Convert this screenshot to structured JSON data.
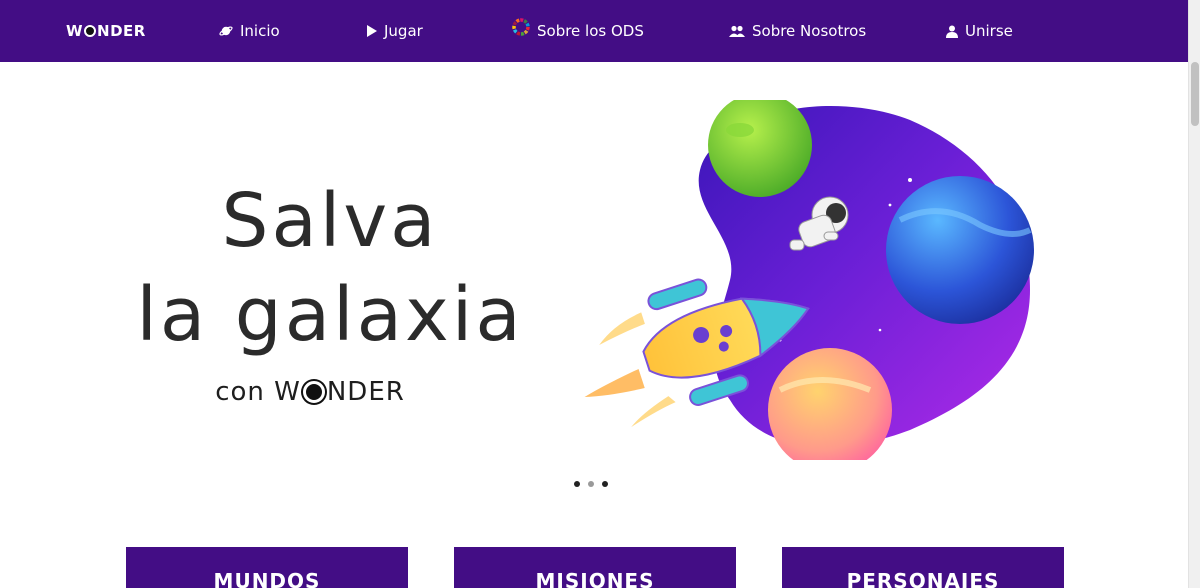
{
  "nav": {
    "brand_left": "W",
    "brand_right": "NDER",
    "items": [
      {
        "label": "Inicio",
        "icon": "planet-icon"
      },
      {
        "label": "Jugar",
        "icon": "play-icon"
      },
      {
        "label": "Sobre los ODS",
        "icon": "sdg-wheel-icon"
      },
      {
        "label": "Sobre Nosotros",
        "icon": "group-icon"
      },
      {
        "label": "Unirse",
        "icon": "user-icon"
      }
    ]
  },
  "hero": {
    "line1": "Salva",
    "line2": "la galaxia",
    "sub_prefix": "con W",
    "sub_suffix": "NDER"
  },
  "carousel": {
    "active_index": 1,
    "count": 3
  },
  "cards": [
    {
      "label": "MUNDOS"
    },
    {
      "label": "MISIONES"
    },
    {
      "label": "PERSONAJES"
    }
  ],
  "colors": {
    "brand": "#430d85",
    "space": "#5a18c9"
  }
}
